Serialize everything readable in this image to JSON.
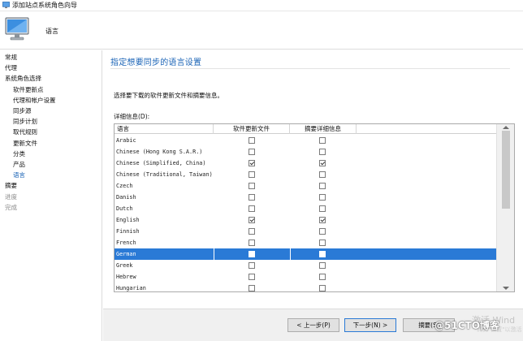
{
  "window": {
    "title": "添加站点系统角色向导"
  },
  "header": {
    "page_name": "语言"
  },
  "sidebar": {
    "items": [
      {
        "label": "常规",
        "level": 0,
        "state": "normal"
      },
      {
        "label": "代理",
        "level": 0,
        "state": "normal"
      },
      {
        "label": "系统角色选择",
        "level": 0,
        "state": "normal"
      },
      {
        "label": "软件更新点",
        "level": 1,
        "state": "normal"
      },
      {
        "label": "代理和帐户设置",
        "level": 1,
        "state": "normal"
      },
      {
        "label": "同步源",
        "level": 1,
        "state": "normal"
      },
      {
        "label": "同步计划",
        "level": 1,
        "state": "normal"
      },
      {
        "label": "取代规则",
        "level": 1,
        "state": "normal"
      },
      {
        "label": "更新文件",
        "level": 1,
        "state": "normal"
      },
      {
        "label": "分类",
        "level": 1,
        "state": "normal"
      },
      {
        "label": "产品",
        "level": 1,
        "state": "normal"
      },
      {
        "label": "语言",
        "level": 1,
        "state": "active"
      },
      {
        "label": "摘要",
        "level": 0,
        "state": "normal"
      },
      {
        "label": "进度",
        "level": 0,
        "state": "disabled"
      },
      {
        "label": "完成",
        "level": 0,
        "state": "disabled"
      }
    ]
  },
  "main": {
    "heading": "指定想要同步的语言设置",
    "description": "选择要下载的软件更新文件和摘要信息。",
    "details_label": "详细信息(D):",
    "grid": {
      "columns": [
        "语言",
        "软件更新文件",
        "摘要详细信息"
      ],
      "rows": [
        {
          "language": "Arabic",
          "update_files": false,
          "summary": false,
          "selected": false
        },
        {
          "language": "Chinese (Hong Kong S.A.R.)",
          "update_files": false,
          "summary": false,
          "selected": false
        },
        {
          "language": "Chinese (Simplified, China)",
          "update_files": true,
          "summary": true,
          "selected": false
        },
        {
          "language": "Chinese (Traditional, Taiwan)",
          "update_files": false,
          "summary": false,
          "selected": false
        },
        {
          "language": "Czech",
          "update_files": false,
          "summary": false,
          "selected": false
        },
        {
          "language": "Danish",
          "update_files": false,
          "summary": false,
          "selected": false
        },
        {
          "language": "Dutch",
          "update_files": false,
          "summary": false,
          "selected": false
        },
        {
          "language": "English",
          "update_files": true,
          "summary": true,
          "selected": false
        },
        {
          "language": "Finnish",
          "update_files": false,
          "summary": false,
          "selected": false
        },
        {
          "language": "French",
          "update_files": false,
          "summary": false,
          "selected": false
        },
        {
          "language": "German",
          "update_files": false,
          "summary": false,
          "selected": true
        },
        {
          "language": "Greek",
          "update_files": false,
          "summary": false,
          "selected": false
        },
        {
          "language": "Hebrew",
          "update_files": false,
          "summary": false,
          "selected": false
        },
        {
          "language": "Hungarian",
          "update_files": false,
          "summary": false,
          "selected": false
        }
      ]
    }
  },
  "footer": {
    "prev_label": "< 上一步(P)",
    "next_label": "下一步(N) >",
    "summary_label": "摘要(S)",
    "watermark_activate": "激活 Wind",
    "watermark_settings": "转到\"设置\"以激活",
    "watermark_blog": "@51CTO博客"
  },
  "colors": {
    "accent": "#1a63b6",
    "selection": "#2a7ad6"
  },
  "icons": {
    "app": "wizard-app-icon",
    "header": "computer-monitor-icon"
  }
}
